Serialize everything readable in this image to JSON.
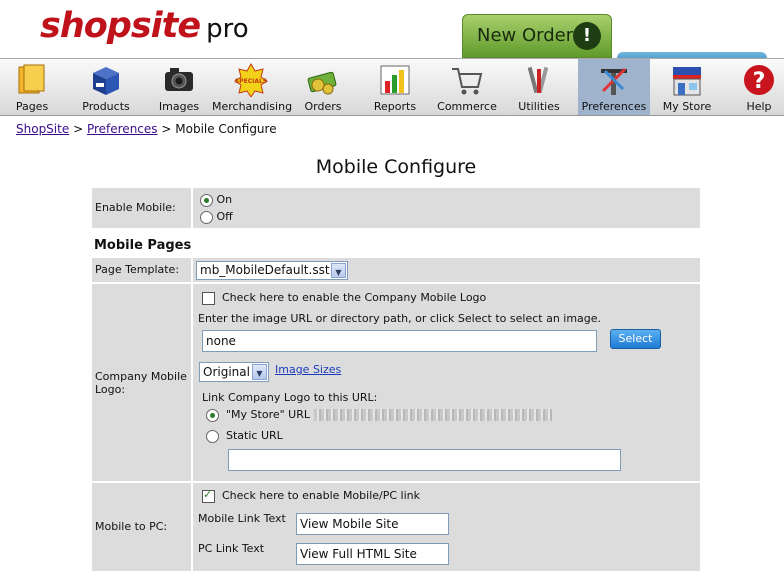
{
  "logo": {
    "shop": "shopsite",
    "pro": "pro"
  },
  "new_order": {
    "label": "New Order",
    "icon_glyph": "!"
  },
  "toolbar": [
    {
      "label": "Pages",
      "icon": "pages-icon"
    },
    {
      "label": "Products",
      "icon": "products-icon"
    },
    {
      "label": "Images",
      "icon": "camera-icon"
    },
    {
      "label": "Merchandising",
      "icon": "specials-icon",
      "badge": "SPECIALS"
    },
    {
      "label": "Orders",
      "icon": "money-icon"
    },
    {
      "label": "Reports",
      "icon": "reports-icon"
    },
    {
      "label": "Commerce",
      "icon": "cart-icon"
    },
    {
      "label": "Utilities",
      "icon": "tools-icon"
    },
    {
      "label": "Preferences",
      "icon": "preferences-icon",
      "active": true
    },
    {
      "label": "My Store",
      "icon": "store-icon"
    },
    {
      "label": "Help",
      "icon": "help-icon",
      "glyph": "?"
    }
  ],
  "breadcrumb": {
    "home": "ShopSite",
    "sep": ">",
    "parent": "Preferences",
    "current": "Mobile Configure"
  },
  "page_title": "Mobile Configure",
  "enable_mobile": {
    "label": "Enable Mobile:",
    "on": "On",
    "off": "Off",
    "selected": "On"
  },
  "section_mobile_pages": "Mobile Pages",
  "page_template": {
    "label": "Page Template:",
    "value": "mb_MobileDefault.sst"
  },
  "company_logo": {
    "label": "Company Mobile Logo:",
    "enable_text": "Check here to enable the Company Mobile Logo",
    "enabled": false,
    "instructions": "Enter the image URL or directory path, or click Select to select an image.",
    "image_value": "none",
    "select_button": "Select",
    "size_value": "Original",
    "image_sizes_link": "Image Sizes",
    "link_label": "Link Company Logo to this URL:",
    "my_store_option": "\"My Store\" URL",
    "static_option": "Static URL",
    "selected": "my_store",
    "static_url_value": ""
  },
  "mobile_to_pc": {
    "label": "Mobile to PC:",
    "enable_text": "Check here to enable Mobile/PC link",
    "enabled": true,
    "mobile_link_label": "Mobile Link Text",
    "mobile_link_value": "View Mobile Site",
    "pc_link_label": "PC Link Text",
    "pc_link_value": "View Full HTML Site"
  },
  "colors": {
    "brand_red": "#c0121b",
    "new_order_green": "#6aa532",
    "active_tab": "#9fb4cc",
    "link_purple": "#3a0c8c",
    "row_gray": "#dcdcdc"
  }
}
